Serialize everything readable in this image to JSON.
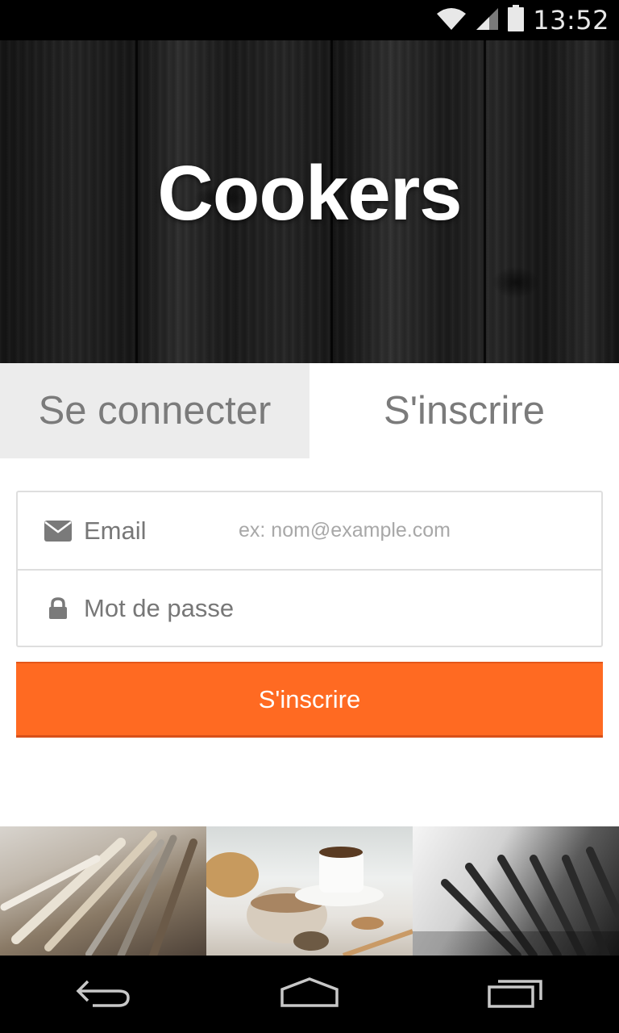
{
  "status_bar": {
    "time": "13:52",
    "icons": [
      "wifi-icon",
      "signal-icon",
      "battery-icon"
    ]
  },
  "hero": {
    "title": "Cookers"
  },
  "tabs": [
    {
      "label": "Se connecter",
      "selected": false
    },
    {
      "label": "S'inscrire",
      "selected": true
    }
  ],
  "form": {
    "email": {
      "icon": "envelope-icon",
      "label": "Email",
      "placeholder": "ex: nom@example.com",
      "value": ""
    },
    "password": {
      "icon": "lock-icon",
      "label": "Mot de passe",
      "placeholder": "",
      "value": ""
    },
    "submit_label": "S'inscrire"
  },
  "photos": [
    {
      "subject": "knives"
    },
    {
      "subject": "coffee-and-bread"
    },
    {
      "subject": "forks"
    }
  ],
  "nav_bar": {
    "icons": [
      "back-icon",
      "home-icon",
      "recent-apps-icon"
    ]
  },
  "colors": {
    "accent": "#ff6a22",
    "tab_inactive_bg": "#ececec",
    "text_muted": "#7b7b7b",
    "border": "#dedede"
  }
}
